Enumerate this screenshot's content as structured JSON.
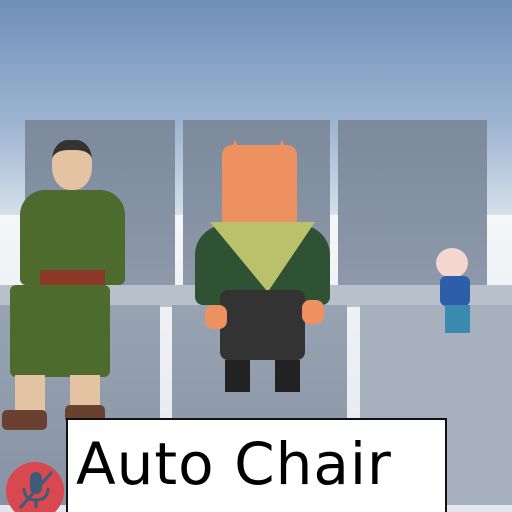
{
  "caption": {
    "text": "Auto Chair"
  },
  "mic_button": {
    "icon": "mic-muted-icon",
    "color": "#d9484f"
  },
  "scene": {
    "chairs": 3,
    "characters": [
      "man-in-kimono",
      "fox",
      "small-girl"
    ]
  }
}
